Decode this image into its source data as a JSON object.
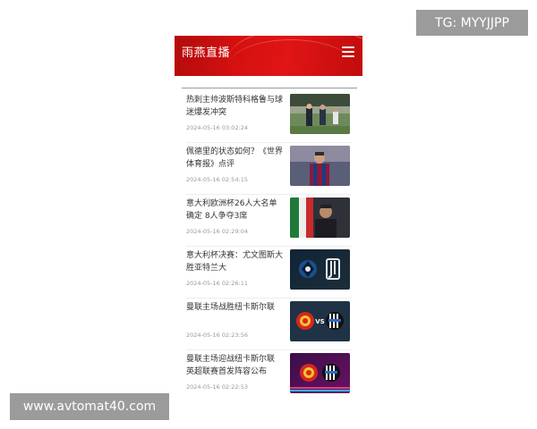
{
  "watermarks": {
    "top": "TG: MYYJJPP",
    "bottom": "www.avtomat40.com"
  },
  "header": {
    "title": "雨燕直播",
    "menu_icon": "hamburger-menu-icon"
  },
  "colors": {
    "header_red": "#d61010",
    "text": "#333333",
    "muted": "#999999"
  },
  "articles": [
    {
      "title": "热刺主帅波斯特科格鲁与球迷爆发冲突",
      "time": "2024-05-16 03:02:24",
      "thumb": "stadium-crowd-photo"
    },
    {
      "title": "佩德里的状态如何？《世界体育报》点评",
      "time": "2024-05-16 02:54:15",
      "thumb": "barcelona-player-photo"
    },
    {
      "title": "意大利欧洲杯26人大名单确定 8人争夺3席",
      "time": "2024-05-16 02:29:04",
      "thumb": "coach-portrait-photo"
    },
    {
      "title": "意大利杯决赛：尤文图斯大胜亚特兰大",
      "time": "2024-05-16 02:26:11",
      "thumb": "atalanta-vs-juventus-logo"
    },
    {
      "title": "曼联主场战胜纽卡斯尔联",
      "time": "2024-05-16 02:23:56",
      "thumb": "manutd-vs-newcastle-logo"
    },
    {
      "title": "曼联主场迎战纽卡斯尔联 英超联赛首发阵容公布",
      "time": "2024-05-16 02:22:53",
      "thumb": "manutd-newcastle-premier-logo"
    }
  ],
  "thumb_labels": {
    "vs": "VS"
  }
}
